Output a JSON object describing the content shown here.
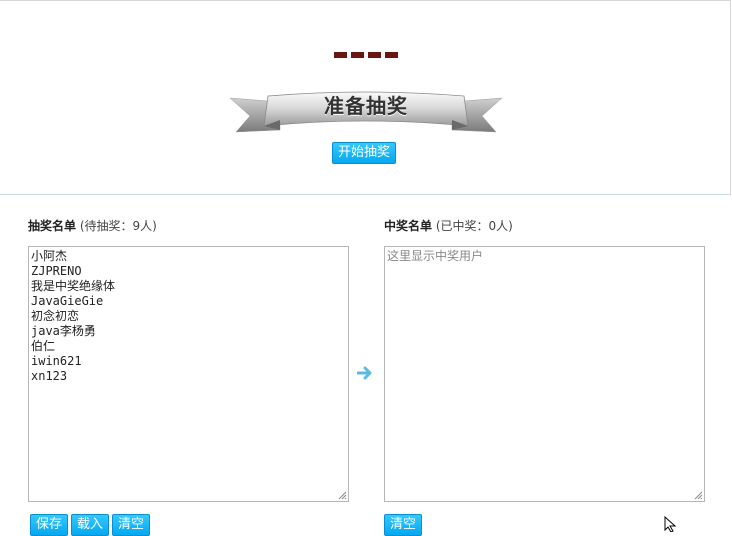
{
  "top": {
    "dashes": "----",
    "ribbon_title": "准备抽奖",
    "start_button": "开始抽奖"
  },
  "left": {
    "title": "抽奖名单",
    "status": "(待抽奖：9人)",
    "names_text": "小阿杰\nZJPRENO\n我是中奖绝缘体\nJavaGieGie\n初念初恋\njava李杨勇\n伯仁\niwin621\nxn123",
    "buttons": [
      "保存",
      "载入",
      "清空"
    ]
  },
  "right": {
    "title": "中奖名单",
    "status": "(已中奖：0人)",
    "placeholder": "这里显示中奖用户",
    "value": "",
    "buttons": [
      "清空"
    ]
  },
  "colors": {
    "accent": "#0aaeee",
    "dash": "#6b1510",
    "arrow": "#5bbbe0"
  },
  "icons": {
    "transfer": "arrow-right-icon",
    "ribbon": "ribbon-banner-icon"
  }
}
